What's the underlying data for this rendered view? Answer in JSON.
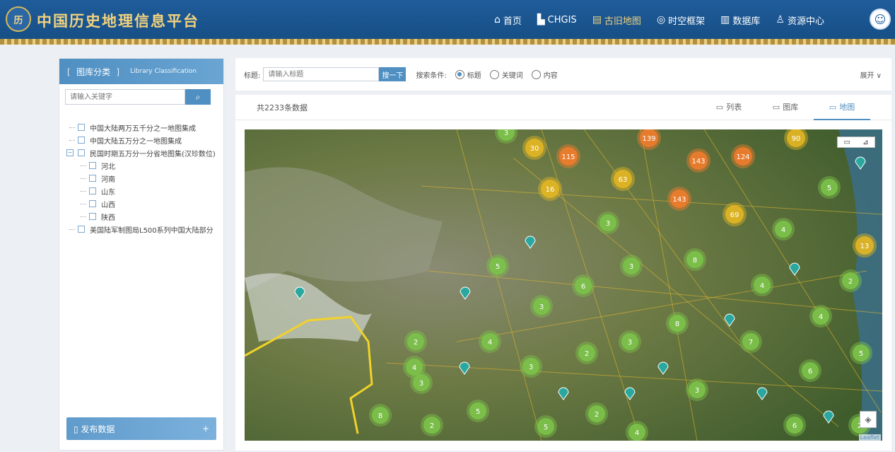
{
  "header": {
    "logo_text": "历",
    "title": "中国历史地理信息平台",
    "nav": [
      {
        "label": "首页",
        "icon": "home-icon"
      },
      {
        "label": "CHGIS",
        "icon": "map-pin-icon"
      },
      {
        "label": "古旧地图",
        "icon": "old-map-icon"
      },
      {
        "label": "时空框架",
        "icon": "globe-icon"
      },
      {
        "label": "数据库",
        "icon": "bar-chart-icon"
      },
      {
        "label": "资源中心",
        "icon": "user-resource-icon"
      }
    ],
    "active_nav": "古旧地图"
  },
  "sidebar": {
    "title": "图库分类",
    "subtitle": "Library Classification",
    "search_placeholder": "请输入关键字",
    "tree": [
      {
        "label": "中国大陆两万五千分之一地图集成",
        "level": 0
      },
      {
        "label": "中国大陆五万分之一地图集成",
        "level": 0
      },
      {
        "label": "民国时期五万分一分省地图集(汉珍数位)",
        "level": 0,
        "expanded": true
      },
      {
        "label": "河北",
        "level": 1
      },
      {
        "label": "河南",
        "level": 1
      },
      {
        "label": "山东",
        "level": 1
      },
      {
        "label": "山西",
        "level": 1
      },
      {
        "label": "陕西",
        "level": 1
      },
      {
        "label": "美国陆军制图局L500系列中国大陆部分",
        "level": 0
      }
    ],
    "publish_label": "发布数据",
    "publish_plus": "+"
  },
  "search": {
    "title_label": "标题:",
    "title_placeholder": "请输入标题",
    "search_button": "搜一下",
    "condition_label": "搜索条件:",
    "options": [
      "标题",
      "关键词",
      "内容"
    ],
    "selected": "标题",
    "expand_label": "展开 ∨"
  },
  "results": {
    "count_text": "共2233条数据",
    "tabs": [
      "列表",
      "图库",
      "地图"
    ],
    "active_tab": "地图"
  },
  "map": {
    "clusters": [
      {
        "n": "3",
        "c": "green"
      },
      {
        "n": "30",
        "c": "yellow"
      },
      {
        "n": "115",
        "c": "orange"
      },
      {
        "n": "139",
        "c": "orange"
      },
      {
        "n": "124",
        "c": "orange"
      },
      {
        "n": "143",
        "c": "orange"
      },
      {
        "n": "90",
        "c": "yellow"
      },
      {
        "n": "63",
        "c": "yellow"
      },
      {
        "n": "16",
        "c": "yellow"
      },
      {
        "n": "143",
        "c": "orange"
      },
      {
        "n": "69",
        "c": "yellow"
      },
      {
        "n": "5",
        "c": "green"
      },
      {
        "n": "3",
        "c": "green"
      },
      {
        "n": "4",
        "c": "green"
      },
      {
        "n": "13",
        "c": "yellow"
      },
      {
        "n": "5",
        "c": "green"
      },
      {
        "n": "3",
        "c": "green"
      },
      {
        "n": "8",
        "c": "green"
      },
      {
        "n": "6",
        "c": "green"
      },
      {
        "n": "4",
        "c": "green"
      },
      {
        "n": "2",
        "c": "green"
      },
      {
        "n": "3",
        "c": "green"
      },
      {
        "n": "8",
        "c": "green"
      },
      {
        "n": "4",
        "c": "green"
      },
      {
        "n": "3",
        "c": "green"
      },
      {
        "n": "2",
        "c": "green"
      },
      {
        "n": "7",
        "c": "green"
      },
      {
        "n": "4",
        "c": "green"
      },
      {
        "n": "4",
        "c": "green"
      },
      {
        "n": "2",
        "c": "green"
      },
      {
        "n": "3",
        "c": "green"
      },
      {
        "n": "5",
        "c": "green"
      },
      {
        "n": "3",
        "c": "green"
      },
      {
        "n": "6",
        "c": "green"
      },
      {
        "n": "3",
        "c": "green"
      },
      {
        "n": "5",
        "c": "green"
      },
      {
        "n": "2",
        "c": "green"
      },
      {
        "n": "8",
        "c": "green"
      },
      {
        "n": "2",
        "c": "green"
      },
      {
        "n": "5",
        "c": "green"
      },
      {
        "n": "4",
        "c": "green"
      },
      {
        "n": "6",
        "c": "green"
      },
      {
        "n": "2",
        "c": "green"
      }
    ],
    "attribution": "Leaflet"
  },
  "colors": {
    "green": "#7cc24a",
    "yellow": "#e2b623",
    "orange": "#ee7c2c",
    "accent": "#4f8fc2"
  }
}
